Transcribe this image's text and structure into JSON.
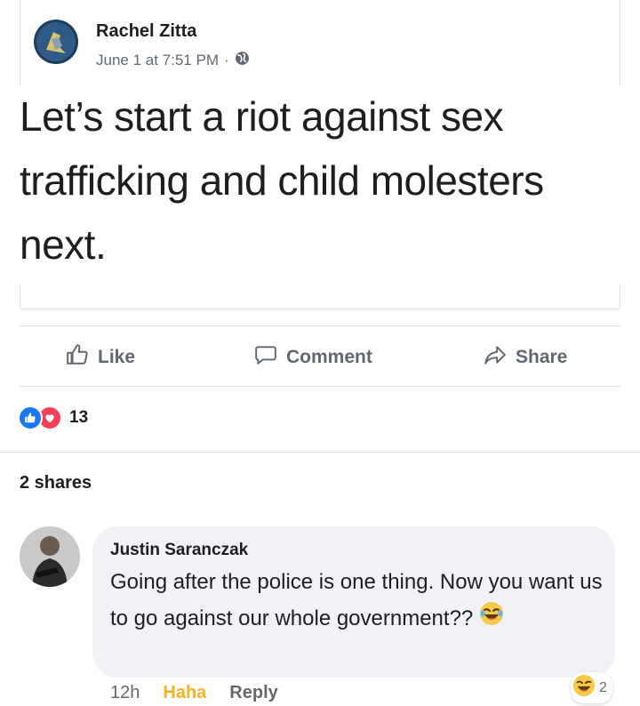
{
  "post": {
    "author": "Rachel Zitta",
    "timestamp": "June 1 at 7:51 PM",
    "separator": "·",
    "privacy_icon": "globe-icon",
    "text": "Let’s start a riot against sex trafficking and child molesters next."
  },
  "actions": {
    "like": "Like",
    "comment": "Comment",
    "share": "Share"
  },
  "reactions": {
    "icons": [
      "like-icon",
      "love-icon"
    ],
    "count": "13"
  },
  "shares": "2 shares",
  "comment": {
    "author": "Justin Saranczak",
    "text": "Going after the police is one thing. Now you want us to go against our whole government??",
    "emoji": "laughing-emoji",
    "time": "12h",
    "haha_label": "Haha",
    "reply_label": "Reply",
    "reaction_count": "2"
  },
  "colors": {
    "accent_blue": "#1877f2",
    "love_red": "#f33e58",
    "haha_yellow": "#f7b125",
    "bubble_bg": "#f0f2f5",
    "secondary_text": "#606770"
  }
}
